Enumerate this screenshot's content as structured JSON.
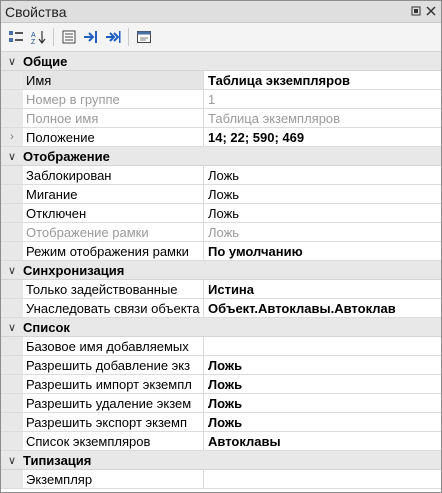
{
  "panel": {
    "title": "Свойства"
  },
  "toolbar": {
    "icons": [
      "categorized-icon",
      "alphabetical-sort-icon",
      "property-pages-icon",
      "go-to-icon",
      "go-to-all-icon",
      "window-icon"
    ]
  },
  "groups": [
    {
      "name": "Общие",
      "rows": [
        {
          "label": "Имя",
          "value": "Таблица экземпляров",
          "bold": true,
          "selected": true
        },
        {
          "label": "Номер в группе",
          "value": "1",
          "disabled": true
        },
        {
          "label": "Полное имя",
          "value": "Таблица экземпляров",
          "disabled": true
        },
        {
          "label": "Положение",
          "value": "14; 22; 590; 469",
          "bold": true,
          "expandable": true
        }
      ]
    },
    {
      "name": "Отображение",
      "rows": [
        {
          "label": "Заблокирован",
          "value": "Ложь"
        },
        {
          "label": "Мигание",
          "value": "Ложь"
        },
        {
          "label": "Отключен",
          "value": "Ложь"
        },
        {
          "label": "Отображение рамки",
          "value": "Ложь",
          "disabled": true
        },
        {
          "label": "Режим отображения рамки",
          "value": "По умолчанию",
          "bold": true
        }
      ]
    },
    {
      "name": "Синхронизация",
      "rows": [
        {
          "label": "Только задействованные",
          "value": "Истина",
          "bold": true
        },
        {
          "label": "Унаследовать связи объекта",
          "value": "Объект.Автоклавы.Автоклав",
          "bold": true
        }
      ]
    },
    {
      "name": "Список",
      "rows": [
        {
          "label": "Базовое имя добавляемых",
          "value": ""
        },
        {
          "label": "Разрешить добавление экз",
          "value": "Ложь",
          "bold": true
        },
        {
          "label": "Разрешить импорт экземпл",
          "value": "Ложь",
          "bold": true
        },
        {
          "label": "Разрешить удаление экзем",
          "value": "Ложь",
          "bold": true
        },
        {
          "label": "Разрешить экспорт экземп",
          "value": "Ложь",
          "bold": true
        },
        {
          "label": "Список экземпляров",
          "value": "Автоклавы",
          "bold": true
        }
      ]
    },
    {
      "name": "Типизация",
      "rows": [
        {
          "label": "Экземпляр",
          "value": ""
        }
      ]
    }
  ]
}
